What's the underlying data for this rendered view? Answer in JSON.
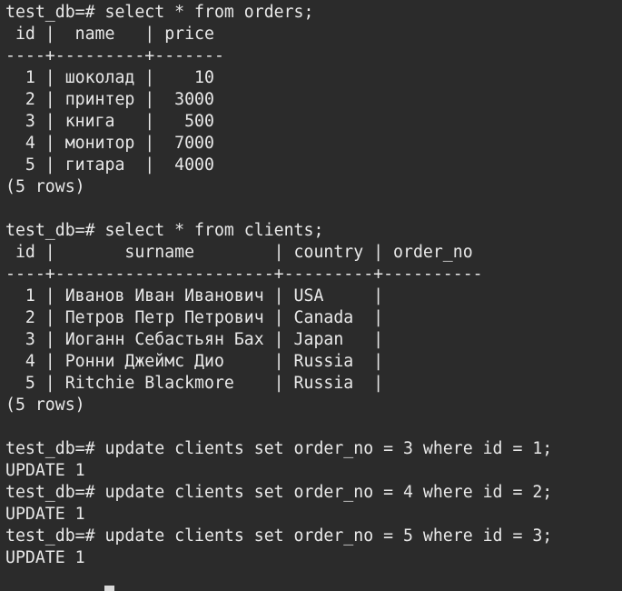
{
  "terminal": {
    "lines": [
      "test_db=# select * from orders;",
      " id |  name   | price ",
      "----+---------+-------",
      "  1 | шоколад |    10",
      "  2 | принтер |  3000",
      "  3 | книга   |   500",
      "  4 | монитор |  7000",
      "  5 | гитара  |  4000",
      "(5 rows)",
      "",
      "test_db=# select * from clients;",
      " id |       surname        | country | order_no ",
      "----+----------------------+---------+----------",
      "  1 | Иванов Иван Иванович | USA     |",
      "  2 | Петров Петр Петрович | Canada  |",
      "  3 | Иоганн Себастьян Бах | Japan   |",
      "  4 | Ронни Джеймс Дио     | Russia  |",
      "  5 | Ritchie Blackmore    | Russia  |",
      "(5 rows)",
      "",
      "test_db=# update clients set order_no = 3 where id = 1;",
      "UPDATE 1",
      "test_db=# update clients set order_no = 4 where id = 2;",
      "UPDATE 1",
      "test_db=# update clients set order_no = 5 where id = 3;",
      "UPDATE 1"
    ]
  }
}
